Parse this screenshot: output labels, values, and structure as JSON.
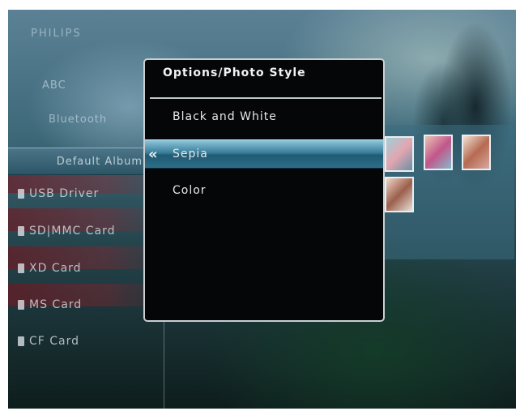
{
  "background_menu": {
    "logo": "PHILIPS",
    "item1": "ABC",
    "item2": "Bluetooth",
    "default_album": "Default Album",
    "sources": [
      "USB Driver",
      "SD|MMC Card",
      "XD Card",
      "MS Card",
      "CF Card"
    ]
  },
  "dialog": {
    "title": "Options/Photo Style",
    "options": [
      {
        "label": "Black and White",
        "selected": false
      },
      {
        "label": "Sepia",
        "selected": true
      },
      {
        "label": "Color",
        "selected": false
      }
    ],
    "selected_arrow_icon": "double-chevron-left-icon"
  }
}
